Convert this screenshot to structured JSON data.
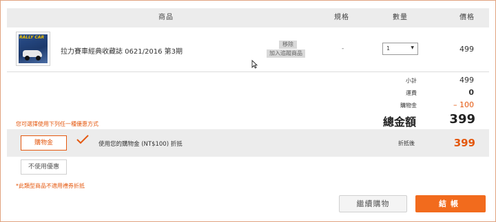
{
  "table_header": {
    "product": "商品",
    "spec": "規格",
    "qty": "數量",
    "price": "價格"
  },
  "item": {
    "thumbnail_text": "RALLY CAR",
    "name": "拉力賽車經典收藏誌 0621/2016 第3期",
    "remove_label": "移除",
    "add_tracking_label": "加入追蹤商品",
    "spec": "-",
    "qty": "1",
    "price": "499"
  },
  "summary": {
    "subtotal_label": "小計",
    "subtotal_value": "499",
    "shipping_label": "運費",
    "shipping_value": "0",
    "coupon_label": "購物金",
    "coupon_value": "– 100",
    "total_label": "總金額",
    "total_value": "399"
  },
  "promo": {
    "choose_note": "您可選擇使用下列任一種優惠方式",
    "coupon_button": "購物金",
    "coupon_desc": "使用您的購物金 (NT$100) 折抵",
    "after_label": "折抵後",
    "after_value": "399",
    "no_discount_button": "不使用優惠",
    "restriction_note": "*此類型商品不適用禮券折抵"
  },
  "actions": {
    "continue": "繼續購物",
    "checkout": "結帳"
  },
  "colors": {
    "accent": "#e4570d",
    "checkout_bg": "#f26b1d",
    "header_bg": "#ececec"
  },
  "icons": {
    "check": "check-icon",
    "cursor": "mouse-cursor-icon",
    "dropdown": "chevron-down-icon"
  }
}
